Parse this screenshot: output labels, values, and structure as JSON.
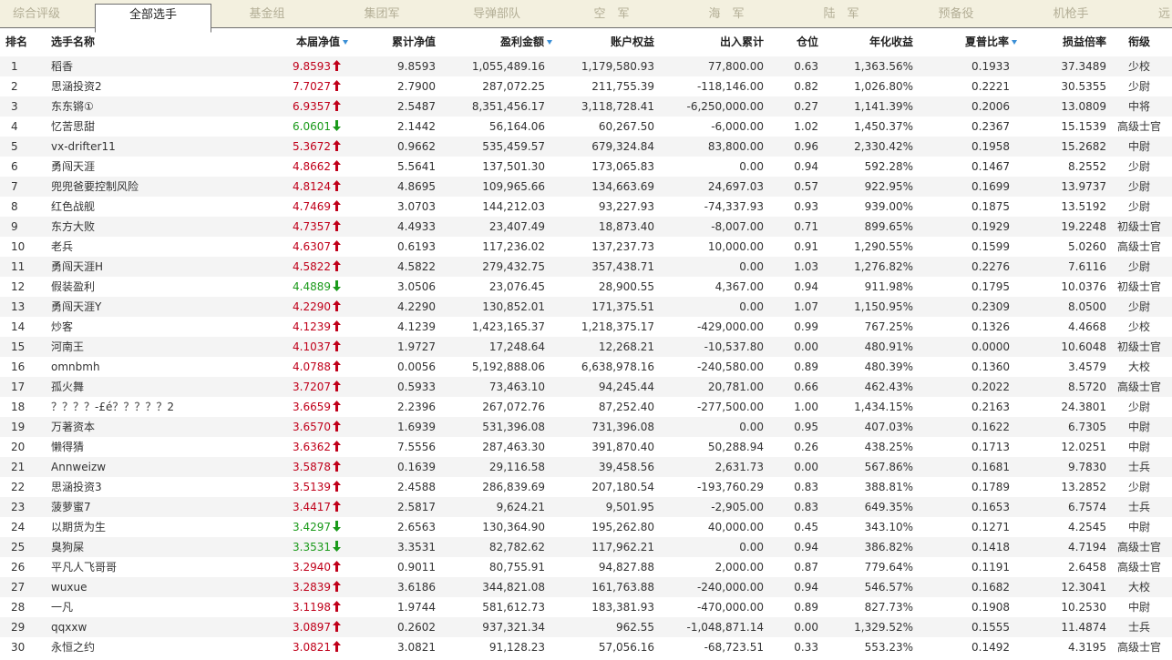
{
  "tabs": [
    "综合评级",
    "全部选手",
    "基金组",
    "集团军",
    "导弹部队",
    "空　军",
    "海　军",
    "陆　军",
    "预备役",
    "机枪手",
    "远"
  ],
  "active_tab": 1,
  "columns": [
    "排名",
    "选手名称",
    "本届净值",
    "累计净值",
    "盈利金额",
    "账户权益",
    "出入累计",
    "仓位",
    "年化收益",
    "夏普比率",
    "损益倍率",
    "衔级"
  ],
  "sorted_columns": [
    2,
    4,
    9
  ],
  "colors": {
    "up": "#c0001a",
    "down": "#1a9a1a",
    "tab_bg": "#f3f0df"
  },
  "rows": [
    {
      "rank": "1",
      "name": "稻香",
      "nav": "9.8593",
      "dir": "up",
      "cum": "9.8593",
      "profit": "1,055,489.16",
      "equity": "1,179,580.93",
      "flow": "77,800.00",
      "pos": "0.63",
      "annual": "1,363.56%",
      "sharpe": "0.1933",
      "pl": "37.3489",
      "grade": "少校"
    },
    {
      "rank": "2",
      "name": "思涵投资2",
      "nav": "7.7027",
      "dir": "up",
      "cum": "2.7900",
      "profit": "287,072.25",
      "equity": "211,755.39",
      "flow": "-118,146.00",
      "pos": "0.82",
      "annual": "1,026.80%",
      "sharpe": "0.2221",
      "pl": "30.5355",
      "grade": "少尉"
    },
    {
      "rank": "3",
      "name": "东东锵①",
      "nav": "6.9357",
      "dir": "up",
      "cum": "2.5487",
      "profit": "8,351,456.17",
      "equity": "3,118,728.41",
      "flow": "-6,250,000.00",
      "pos": "0.27",
      "annual": "1,141.39%",
      "sharpe": "0.2006",
      "pl": "13.0809",
      "grade": "中将"
    },
    {
      "rank": "4",
      "name": "忆苦思甜",
      "nav": "6.0601",
      "dir": "down",
      "cum": "2.1442",
      "profit": "56,164.06",
      "equity": "60,267.50",
      "flow": "-6,000.00",
      "pos": "1.02",
      "annual": "1,450.37%",
      "sharpe": "0.2367",
      "pl": "15.1539",
      "grade": "高级士官"
    },
    {
      "rank": "5",
      "name": "vx-drifter11",
      "nav": "5.3672",
      "dir": "up",
      "cum": "0.9662",
      "profit": "535,459.57",
      "equity": "679,324.84",
      "flow": "83,800.00",
      "pos": "0.96",
      "annual": "2,330.42%",
      "sharpe": "0.1958",
      "pl": "15.2682",
      "grade": "中尉"
    },
    {
      "rank": "6",
      "name": "勇闯天涯",
      "nav": "4.8662",
      "dir": "up",
      "cum": "5.5641",
      "profit": "137,501.30",
      "equity": "173,065.83",
      "flow": "0.00",
      "pos": "0.94",
      "annual": "592.28%",
      "sharpe": "0.1467",
      "pl": "8.2552",
      "grade": "少尉"
    },
    {
      "rank": "7",
      "name": "兜兜爸要控制风险",
      "nav": "4.8124",
      "dir": "up",
      "cum": "4.8695",
      "profit": "109,965.66",
      "equity": "134,663.69",
      "flow": "24,697.03",
      "pos": "0.57",
      "annual": "922.95%",
      "sharpe": "0.1699",
      "pl": "13.9737",
      "grade": "少尉"
    },
    {
      "rank": "8",
      "name": "红色战舰",
      "nav": "4.7469",
      "dir": "up",
      "cum": "3.0703",
      "profit": "144,212.03",
      "equity": "93,227.93",
      "flow": "-74,337.93",
      "pos": "0.93",
      "annual": "939.00%",
      "sharpe": "0.1875",
      "pl": "13.5192",
      "grade": "少尉"
    },
    {
      "rank": "9",
      "name": "东方大败",
      "nav": "4.7357",
      "dir": "up",
      "cum": "4.4933",
      "profit": "23,407.49",
      "equity": "18,873.40",
      "flow": "-8,007.00",
      "pos": "0.71",
      "annual": "899.65%",
      "sharpe": "0.1929",
      "pl": "19.2248",
      "grade": "初级士官"
    },
    {
      "rank": "10",
      "name": "老兵",
      "nav": "4.6307",
      "dir": "up",
      "cum": "0.6193",
      "profit": "117,236.02",
      "equity": "137,237.73",
      "flow": "10,000.00",
      "pos": "0.91",
      "annual": "1,290.55%",
      "sharpe": "0.1599",
      "pl": "5.0260",
      "grade": "高级士官"
    },
    {
      "rank": "11",
      "name": "勇闯天涯H",
      "nav": "4.5822",
      "dir": "up",
      "cum": "4.5822",
      "profit": "279,432.75",
      "equity": "357,438.71",
      "flow": "0.00",
      "pos": "1.03",
      "annual": "1,276.82%",
      "sharpe": "0.2276",
      "pl": "7.6116",
      "grade": "少尉"
    },
    {
      "rank": "12",
      "name": "假装盈利",
      "nav": "4.4889",
      "dir": "down",
      "cum": "3.0506",
      "profit": "23,076.45",
      "equity": "28,900.55",
      "flow": "4,367.00",
      "pos": "0.94",
      "annual": "911.98%",
      "sharpe": "0.1795",
      "pl": "10.0376",
      "grade": "初级士官"
    },
    {
      "rank": "13",
      "name": "勇闯天涯Y",
      "nav": "4.2290",
      "dir": "up",
      "cum": "4.2290",
      "profit": "130,852.01",
      "equity": "171,375.51",
      "flow": "0.00",
      "pos": "1.07",
      "annual": "1,150.95%",
      "sharpe": "0.2309",
      "pl": "8.0500",
      "grade": "少尉"
    },
    {
      "rank": "14",
      "name": "炒客",
      "nav": "4.1239",
      "dir": "up",
      "cum": "4.1239",
      "profit": "1,423,165.37",
      "equity": "1,218,375.17",
      "flow": "-429,000.00",
      "pos": "0.99",
      "annual": "767.25%",
      "sharpe": "0.1326",
      "pl": "4.4668",
      "grade": "少校"
    },
    {
      "rank": "15",
      "name": "河南王",
      "nav": "4.1037",
      "dir": "up",
      "cum": "1.9727",
      "profit": "17,248.64",
      "equity": "12,268.21",
      "flow": "-10,537.80",
      "pos": "0.00",
      "annual": "480.91%",
      "sharpe": "0.0000",
      "pl": "10.6048",
      "grade": "初级士官"
    },
    {
      "rank": "16",
      "name": "omnbmh",
      "nav": "4.0788",
      "dir": "up",
      "cum": "0.0056",
      "profit": "5,192,888.06",
      "equity": "6,638,978.16",
      "flow": "-240,580.00",
      "pos": "0.89",
      "annual": "480.39%",
      "sharpe": "0.1360",
      "pl": "3.4579",
      "grade": "大校"
    },
    {
      "rank": "17",
      "name": "孤火舞",
      "nav": "3.7207",
      "dir": "up",
      "cum": "0.5933",
      "profit": "73,463.10",
      "equity": "94,245.44",
      "flow": "20,781.00",
      "pos": "0.66",
      "annual": "462.43%",
      "sharpe": "0.2022",
      "pl": "8.5720",
      "grade": "高级士官"
    },
    {
      "rank": "18",
      "name": "？？？？-£é？？？？？2",
      "nav": "3.6659",
      "dir": "up",
      "cum": "2.2396",
      "profit": "267,072.76",
      "equity": "87,252.40",
      "flow": "-277,500.00",
      "pos": "1.00",
      "annual": "1,434.15%",
      "sharpe": "0.2163",
      "pl": "24.3801",
      "grade": "少尉"
    },
    {
      "rank": "19",
      "name": "万著资本",
      "nav": "3.6570",
      "dir": "up",
      "cum": "1.6939",
      "profit": "531,396.08",
      "equity": "731,396.08",
      "flow": "0.00",
      "pos": "0.95",
      "annual": "407.03%",
      "sharpe": "0.1622",
      "pl": "6.7305",
      "grade": "中尉"
    },
    {
      "rank": "20",
      "name": "懒得猜",
      "nav": "3.6362",
      "dir": "up",
      "cum": "7.5556",
      "profit": "287,463.30",
      "equity": "391,870.40",
      "flow": "50,288.94",
      "pos": "0.26",
      "annual": "438.25%",
      "sharpe": "0.1713",
      "pl": "12.0251",
      "grade": "中尉"
    },
    {
      "rank": "21",
      "name": "Annweizw",
      "nav": "3.5878",
      "dir": "up",
      "cum": "0.1639",
      "profit": "29,116.58",
      "equity": "39,458.56",
      "flow": "2,631.73",
      "pos": "0.00",
      "annual": "567.86%",
      "sharpe": "0.1681",
      "pl": "9.7830",
      "grade": "士兵"
    },
    {
      "rank": "22",
      "name": "思涵投资3",
      "nav": "3.5139",
      "dir": "up",
      "cum": "2.4588",
      "profit": "286,839.69",
      "equity": "207,180.54",
      "flow": "-193,760.29",
      "pos": "0.83",
      "annual": "388.81%",
      "sharpe": "0.1789",
      "pl": "13.2852",
      "grade": "少尉"
    },
    {
      "rank": "23",
      "name": "菠萝蜜7",
      "nav": "3.4417",
      "dir": "up",
      "cum": "2.5817",
      "profit": "9,624.21",
      "equity": "9,501.95",
      "flow": "-2,905.00",
      "pos": "0.83",
      "annual": "649.35%",
      "sharpe": "0.1653",
      "pl": "6.7574",
      "grade": "士兵"
    },
    {
      "rank": "24",
      "name": "以期货为生",
      "nav": "3.4297",
      "dir": "down",
      "cum": "2.6563",
      "profit": "130,364.90",
      "equity": "195,262.80",
      "flow": "40,000.00",
      "pos": "0.45",
      "annual": "343.10%",
      "sharpe": "0.1271",
      "pl": "4.2545",
      "grade": "中尉"
    },
    {
      "rank": "25",
      "name": "臭狗屎",
      "nav": "3.3531",
      "dir": "down",
      "cum": "3.3531",
      "profit": "82,782.62",
      "equity": "117,962.21",
      "flow": "0.00",
      "pos": "0.94",
      "annual": "386.82%",
      "sharpe": "0.1418",
      "pl": "4.7194",
      "grade": "高级士官"
    },
    {
      "rank": "26",
      "name": "平凡人飞哥哥",
      "nav": "3.2940",
      "dir": "up",
      "cum": "0.9011",
      "profit": "80,755.91",
      "equity": "94,827.88",
      "flow": "2,000.00",
      "pos": "0.87",
      "annual": "779.64%",
      "sharpe": "0.1191",
      "pl": "2.6458",
      "grade": "高级士官"
    },
    {
      "rank": "27",
      "name": "wuxue",
      "nav": "3.2839",
      "dir": "up",
      "cum": "3.6186",
      "profit": "344,821.08",
      "equity": "161,763.88",
      "flow": "-240,000.00",
      "pos": "0.94",
      "annual": "546.57%",
      "sharpe": "0.1682",
      "pl": "12.3041",
      "grade": "大校"
    },
    {
      "rank": "28",
      "name": "一凡",
      "nav": "3.1198",
      "dir": "up",
      "cum": "1.9744",
      "profit": "581,612.73",
      "equity": "183,381.93",
      "flow": "-470,000.00",
      "pos": "0.89",
      "annual": "827.73%",
      "sharpe": "0.1908",
      "pl": "10.2530",
      "grade": "中尉"
    },
    {
      "rank": "29",
      "name": "qqxxw",
      "nav": "3.0897",
      "dir": "up",
      "cum": "0.2602",
      "profit": "937,321.34",
      "equity": "962.55",
      "flow": "-1,048,871.14",
      "pos": "0.00",
      "annual": "1,329.52%",
      "sharpe": "0.1555",
      "pl": "11.4874",
      "grade": "士兵"
    },
    {
      "rank": "30",
      "name": "永恒之约",
      "nav": "3.0821",
      "dir": "up",
      "cum": "3.0821",
      "profit": "91,128.23",
      "equity": "57,056.16",
      "flow": "-68,723.51",
      "pos": "0.33",
      "annual": "553.23%",
      "sharpe": "0.1492",
      "pl": "4.3195",
      "grade": "高级士官"
    }
  ]
}
